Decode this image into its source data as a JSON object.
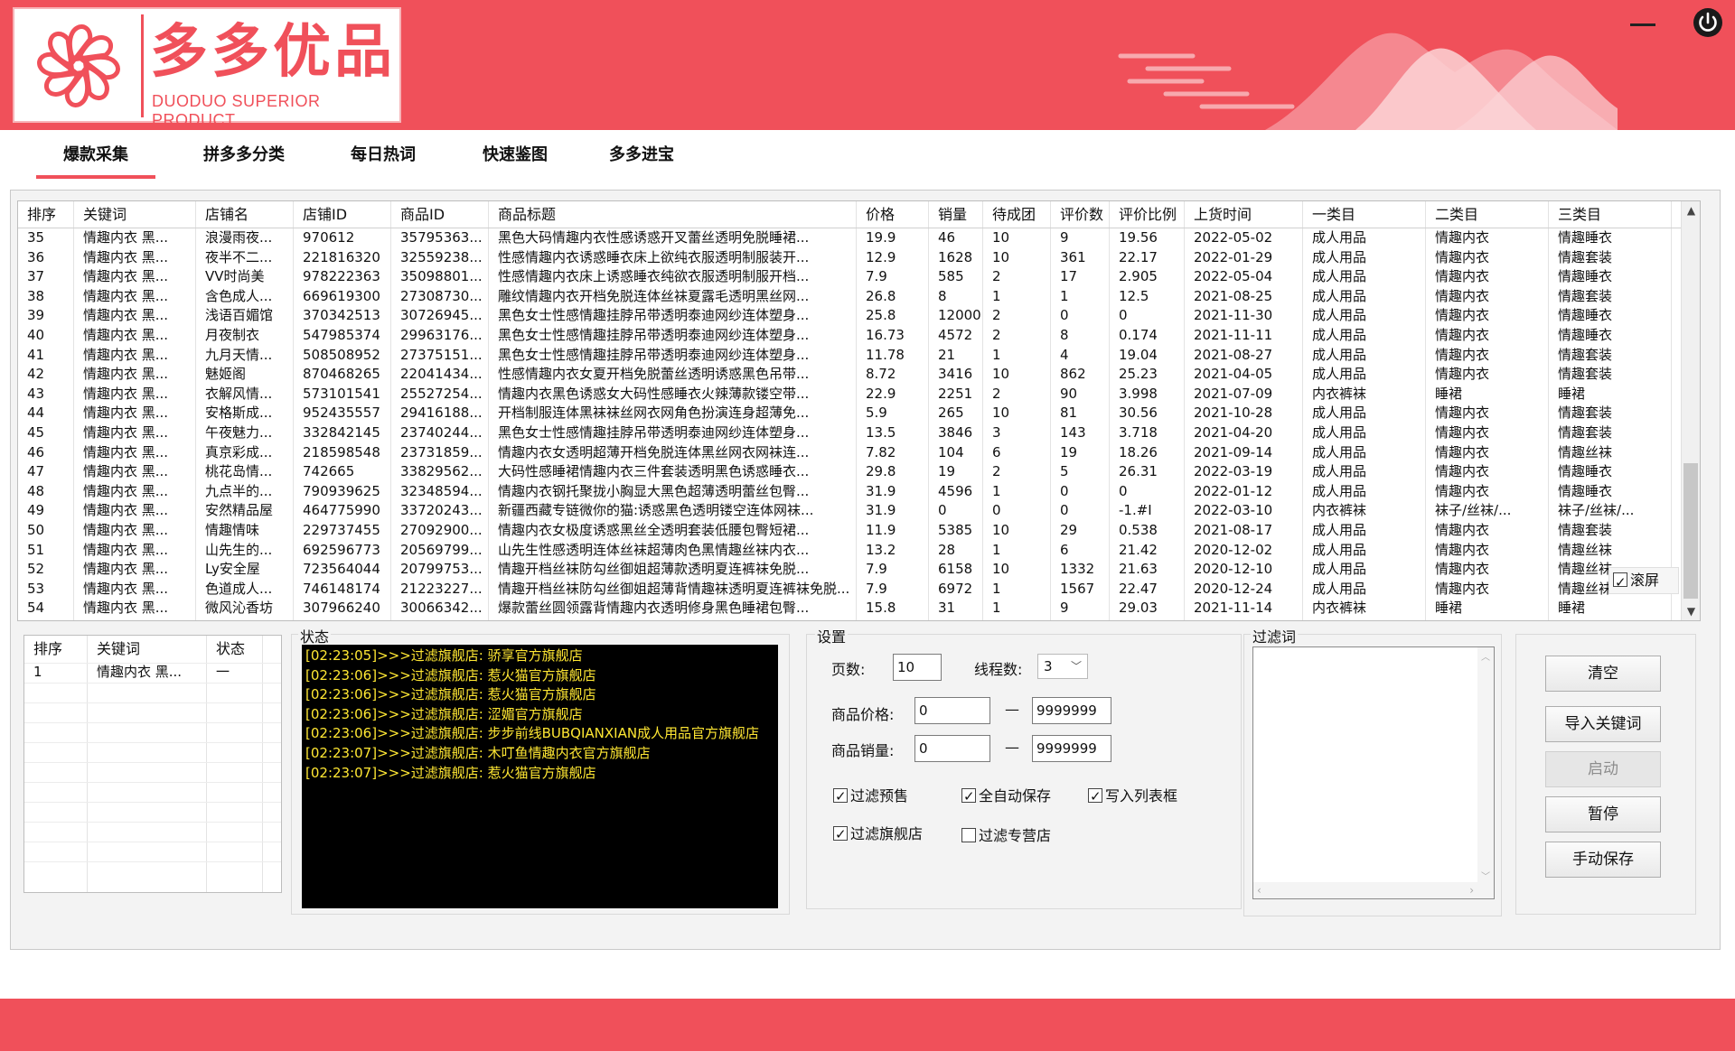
{
  "header": {
    "logo_title": "多多优品",
    "logo_subtitle": "DUODUO SUPERIOR PRODUCT",
    "brand_color": "#f0505a"
  },
  "tabs": [
    {
      "label": "爆款采集",
      "active": true
    },
    {
      "label": "拼多多分类",
      "active": false
    },
    {
      "label": "每日热词",
      "active": false
    },
    {
      "label": "快速鉴图",
      "active": false
    },
    {
      "label": "多多进宝",
      "active": false
    }
  ],
  "results": {
    "columns": [
      "排序",
      "关键词",
      "店铺名",
      "店铺ID",
      "商品ID",
      "商品标题",
      "价格",
      "销量",
      "待成团",
      "评价数",
      "评价比例",
      "上货时间",
      "一类目",
      "二类目",
      "三类目"
    ],
    "rows": [
      [
        "35",
        "情趣内衣 黑...",
        "浪漫雨夜...",
        "970612",
        "35795363...",
        "黑色大码情趣内衣性感诱惑开叉蕾丝透明免脱睡裙...",
        "19.9",
        "46",
        "10",
        "9",
        "19.56",
        "2022-05-02",
        "成人用品",
        "情趣内衣",
        "情趣睡衣"
      ],
      [
        "36",
        "情趣内衣 黑...",
        "夜半不二...",
        "221816320",
        "32559238...",
        "性感情趣内衣诱惑睡衣床上欲纯衣服透明制服装开...",
        "12.9",
        "1628",
        "10",
        "361",
        "22.17",
        "2022-01-29",
        "成人用品",
        "情趣内衣",
        "情趣套装"
      ],
      [
        "37",
        "情趣内衣 黑...",
        "VV时尚美",
        "978222363",
        "35098801...",
        "性感情趣内衣床上诱惑睡衣纯欲衣服透明制服开档...",
        "7.9",
        "585",
        "2",
        "17",
        "2.905",
        "2022-05-04",
        "成人用品",
        "情趣内衣",
        "情趣睡衣"
      ],
      [
        "38",
        "情趣内衣 黑...",
        "含色成人...",
        "669619300",
        "27308730...",
        "雕纹情趣内衣开档免脱连体丝袜夏露毛透明黑丝网...",
        "26.8",
        "8",
        "1",
        "1",
        "12.5",
        "2021-08-25",
        "成人用品",
        "情趣内衣",
        "情趣套装"
      ],
      [
        "39",
        "情趣内衣 黑...",
        "浅语百媚馆",
        "370342513",
        "30726945...",
        "黑色女士性感情趣挂脖吊带透明泰迪网纱连体塑身...",
        "25.8",
        "12000",
        "2",
        "0",
        "0",
        "2021-11-30",
        "成人用品",
        "情趣内衣",
        "情趣睡衣"
      ],
      [
        "40",
        "情趣内衣 黑...",
        "月夜制衣",
        "547985374",
        "29963176...",
        "黑色女士性感情趣挂脖吊带透明泰迪网纱连体塑身...",
        "16.73",
        "4572",
        "2",
        "8",
        "0.174",
        "2021-11-11",
        "成人用品",
        "情趣内衣",
        "情趣睡衣"
      ],
      [
        "41",
        "情趣内衣 黑...",
        "九月天情...",
        "508508952",
        "27375151...",
        "黑色女士性感情趣挂脖吊带透明泰迪网纱连体塑身...",
        "11.78",
        "21",
        "1",
        "4",
        "19.04",
        "2021-08-27",
        "成人用品",
        "情趣内衣",
        "情趣套装"
      ],
      [
        "42",
        "情趣内衣 黑...",
        "魅姬阁",
        "870468265",
        "22041434...",
        "性感情趣内衣女夏开档免脱蕾丝透明诱惑黑色吊带...",
        "8.72",
        "3416",
        "10",
        "862",
        "25.23",
        "2021-04-05",
        "成人用品",
        "情趣内衣",
        "情趣套装"
      ],
      [
        "43",
        "情趣内衣 黑...",
        "衣解风情...",
        "573101541",
        "25527254...",
        "情趣内衣黑色诱惑女大码性感睡衣火辣薄款镂空带...",
        "22.9",
        "2251",
        "2",
        "90",
        "3.998",
        "2021-07-09",
        "内衣裤袜",
        "睡裙",
        "睡裙"
      ],
      [
        "44",
        "情趣内衣 黑...",
        "安格斯成...",
        "952435557",
        "29416188...",
        "开档制服连体黑袜袜丝网衣网角色扮演连身超薄免...",
        "5.9",
        "265",
        "10",
        "81",
        "30.56",
        "2021-10-28",
        "成人用品",
        "情趣内衣",
        "情趣套装"
      ],
      [
        "45",
        "情趣内衣 黑...",
        "午夜魅力...",
        "332842145",
        "23740244...",
        "黑色女士性感情趣挂脖吊带透明泰迪网纱连体塑身...",
        "13.5",
        "3846",
        "3",
        "143",
        "3.718",
        "2021-04-20",
        "成人用品",
        "情趣内衣",
        "情趣套装"
      ],
      [
        "46",
        "情趣内衣 黑...",
        "真京彩成...",
        "218598548",
        "23731859...",
        "情趣内衣女透明超薄开档免脱连体黑丝网衣网袜连...",
        "7.82",
        "104",
        "6",
        "19",
        "18.26",
        "2021-09-14",
        "成人用品",
        "情趣内衣",
        "情趣丝袜"
      ],
      [
        "47",
        "情趣内衣 黑...",
        "桃花岛情...",
        "742665",
        "33829562...",
        "大码性感睡裙情趣内衣三件套装透明黑色诱惑睡衣...",
        "29.8",
        "19",
        "2",
        "5",
        "26.31",
        "2022-03-19",
        "成人用品",
        "情趣内衣",
        "情趣睡衣"
      ],
      [
        "48",
        "情趣内衣 黑...",
        "九点半的...",
        "790939625",
        "32348594...",
        "情趣内衣钢托聚拢小胸显大黑色超薄透明蕾丝包臀...",
        "31.9",
        "4596",
        "1",
        "0",
        "0",
        "2022-01-12",
        "成人用品",
        "情趣内衣",
        "情趣睡衣"
      ],
      [
        "49",
        "情趣内衣 黑...",
        "安然精品屋",
        "464775990",
        "33720243...",
        "新疆西藏专链微你的猫:诱惑黑色透明镂空连体网袜...",
        "31.9",
        "0",
        "0",
        "0",
        "-1.#I",
        "2022-03-10",
        "内衣裤袜",
        "袜子/丝袜/...",
        "袜子/丝袜/..."
      ],
      [
        "50",
        "情趣内衣 黑...",
        "情趣情味",
        "229737455",
        "27092900...",
        "情趣内衣女极度诱惑黑丝全透明套装低腰包臀短裙...",
        "11.9",
        "5385",
        "10",
        "29",
        "0.538",
        "2021-08-17",
        "成人用品",
        "情趣内衣",
        "情趣套装"
      ],
      [
        "51",
        "情趣内衣 黑...",
        "山先生的...",
        "692596773",
        "20569799...",
        "山先生性感透明连体丝袜超薄肉色黑情趣丝袜内衣...",
        "13.2",
        "28",
        "1",
        "6",
        "21.42",
        "2020-12-02",
        "成人用品",
        "情趣内衣",
        "情趣丝袜"
      ],
      [
        "52",
        "情趣内衣 黑...",
        "Ly安全屋",
        "723564044",
        "20799753...",
        "情趣开档丝袜防勾丝御姐超薄款透明夏连裤袜免脱...",
        "7.9",
        "6158",
        "10",
        "1332",
        "21.63",
        "2020-12-10",
        "成人用品",
        "情趣内衣",
        "情趣丝袜"
      ],
      [
        "53",
        "情趣内衣 黑...",
        "色道成人...",
        "746148174",
        "21223227...",
        "情趣开档丝袜防勾丝御姐超薄背情趣袜透明夏连裤袜免脱...",
        "7.9",
        "6972",
        "1",
        "1567",
        "22.47",
        "2020-12-24",
        "成人用品",
        "情趣内衣",
        "情趣丝袜"
      ],
      [
        "54",
        "情趣内衣 黑...",
        "微风沁香坊",
        "307966240",
        "30066342...",
        "爆款蕾丝圆领露背情趣内衣透明修身黑色睡裙包臀...",
        "15.8",
        "31",
        "1",
        "9",
        "29.03",
        "2021-11-14",
        "内衣裤袜",
        "睡裙",
        "睡裙"
      ]
    ],
    "scroll_screen_label": "滚屏",
    "scroll_screen_checked": true
  },
  "keywords": {
    "columns": [
      "排序",
      "关键词",
      "状态"
    ],
    "rows": [
      [
        "1",
        "情趣内衣 黑...",
        "一"
      ]
    ]
  },
  "status": {
    "label": "状态",
    "lines": [
      "[02:23:05]>>>过滤旗舰店: 骄享官方旗舰店",
      "[02:23:06]>>>过滤旗舰店: 惹火猫官方旗舰店",
      "[02:23:06]>>>过滤旗舰店: 惹火猫官方旗舰店",
      "[02:23:06]>>>过滤旗舰店: 涩媚官方旗舰店",
      "[02:23:06]>>>过滤旗舰店: 步步前线BUBQIANXIAN成人用品官方旗舰店",
      "[02:23:07]>>>过滤旗舰店: 木叮鱼情趣内衣官方旗舰店",
      "[02:23:07]>>>过滤旗舰店: 惹火猫官方旗舰店"
    ],
    "log_color": "#ffe733"
  },
  "settings": {
    "label": "设置",
    "pages_label": "页数:",
    "pages_value": "10",
    "threads_label": "线程数:",
    "threads_value": "3",
    "price_label": "商品价格:",
    "price_min": "0",
    "price_max": "9999999",
    "sales_label": "商品销量:",
    "sales_min": "0",
    "sales_max": "9999999",
    "dash": "—",
    "checkboxes": [
      {
        "label": "过滤预售",
        "checked": true
      },
      {
        "label": "全自动保存",
        "checked": true
      },
      {
        "label": "写入列表框",
        "checked": true
      },
      {
        "label": "过滤旗舰店",
        "checked": true
      },
      {
        "label": "过滤专营店",
        "checked": false
      }
    ]
  },
  "filter": {
    "label": "过滤词",
    "value": ""
  },
  "buttons": {
    "clear": "清空",
    "import_keywords": "导入关键词",
    "start": "启动",
    "pause": "暂停",
    "manual_save": "手动保存"
  }
}
